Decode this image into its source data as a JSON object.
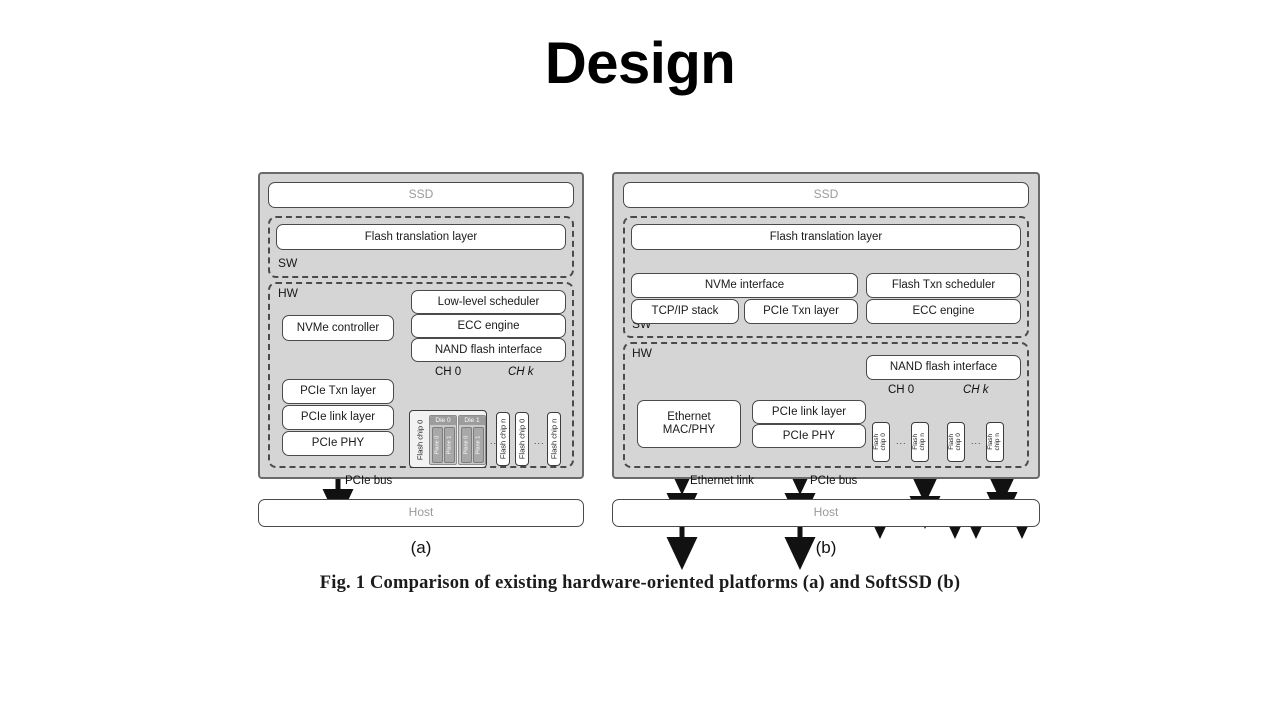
{
  "slide": {
    "title": "Design"
  },
  "figure": {
    "caption": "Fig. 1  Comparison of existing hardware-oriented platforms (a) and SoftSSD (b)",
    "panel_a": {
      "sublabel": "(a)",
      "ssd_label": "SSD",
      "host_label": "Host",
      "sw_label": "SW",
      "hw_label": "HW",
      "bus_label": "PCIe bus",
      "boxes": {
        "ftl": "Flash translation layer",
        "nvme_controller": "NVMe controller",
        "pcie_txn": "PCIe Txn layer",
        "pcie_link": "PCIe link layer",
        "pcie_phy": "PCIe PHY",
        "low_level_scheduler": "Low-level scheduler",
        "ecc_engine": "ECC engine",
        "nand_flash_interface": "NAND flash interface"
      },
      "channels": {
        "ch0": "CH 0",
        "chk": "CH k"
      },
      "flash": {
        "chip0": "Flash chip 0",
        "chipn": "Flash chip n",
        "die0": "Die 0",
        "die1": "Die 1",
        "plane0": "Plane 0",
        "plane1": "Plane 1",
        "ellipsis": "..."
      }
    },
    "panel_b": {
      "sublabel": "(b)",
      "ssd_label": "SSD",
      "host_label": "Host",
      "sw_label": "SW",
      "hw_label": "HW",
      "ethernet_link_label": "Ethernet link",
      "bus_label": "PCIe bus",
      "boxes": {
        "ftl": "Flash translation layer",
        "nvme_interface": "NVMe interface",
        "flash_txn_scheduler": "Flash Txn scheduler",
        "tcpip_stack": "TCP/IP stack",
        "pcie_txn": "PCIe Txn layer",
        "ecc_engine": "ECC engine",
        "nand_flash_interface": "NAND flash interface",
        "ethernet_mac_phy_line1": "Ethernet",
        "ethernet_mac_phy_line2": "MAC/PHY",
        "pcie_link": "PCIe link layer",
        "pcie_phy": "PCIe PHY"
      },
      "channels": {
        "ch0": "CH 0",
        "chk": "CH k"
      },
      "flash": {
        "chip_line1": "Flash",
        "chip0_line2": "chip 0",
        "chipn_line2": "chip n",
        "ellipsis": "..."
      }
    }
  },
  "colors": {
    "panel_bg": "#d5d5d5",
    "panel_border": "#6a6a6a",
    "box_fill": "#ffffff",
    "box_border": "#4a4a4a",
    "arrow": "#111111",
    "muted_text": "#9a9a9a"
  }
}
